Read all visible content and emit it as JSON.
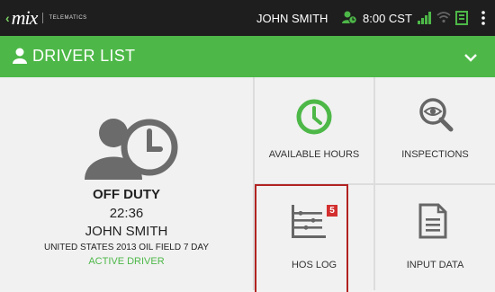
{
  "status_bar": {
    "brand_logo": "mix",
    "brand_sub": "TELEMATICS",
    "user": "JOHN SMITH",
    "time": "8:00 CST",
    "icons": [
      "driver-status-icon",
      "signal-icon",
      "wifi-icon",
      "log-icon",
      "overflow-menu-icon"
    ]
  },
  "header": {
    "title": "DRIVER LIST",
    "icon": "person-icon",
    "chevron": "chevron-down-icon"
  },
  "driver": {
    "status": "OFF DUTY",
    "time": "22:36",
    "name": "JOHN SMITH",
    "ruleset": "UNITED STATES 2013 OIL FIELD 7 DAY",
    "role": "ACTIVE DRIVER"
  },
  "tiles": [
    {
      "label": "AVAILABLE HOURS",
      "icon": "clock-icon"
    },
    {
      "label": "INSPECTIONS",
      "icon": "magnifier-eye-icon"
    },
    {
      "label": "HOS LOG",
      "icon": "hos-log-icon",
      "badge": "5"
    },
    {
      "label": "INPUT DATA",
      "icon": "document-icon"
    }
  ],
  "colors": {
    "accent": "#4db848",
    "dark": "#1e1e1e",
    "badge": "#d32f2f",
    "highlight": "#b22222"
  }
}
